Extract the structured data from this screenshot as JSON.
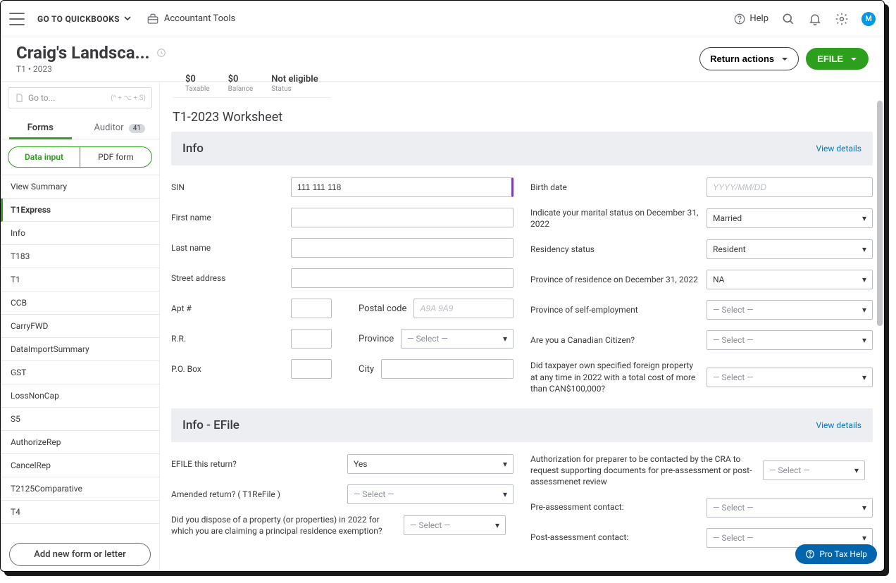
{
  "topbar": {
    "go_to_quickbooks": "GO TO QUICKBOOKS",
    "accountant_tools": "Accountant Tools",
    "help": "Help",
    "avatar_letter": "M"
  },
  "header": {
    "title": "Craig's Landsca...",
    "subtitle": "T1 • 2023",
    "return_actions": "Return actions",
    "efile": "EFILE"
  },
  "summary": {
    "taxable_val": "$0",
    "taxable_lab": "Taxable",
    "balance_val": "$0",
    "balance_lab": "Balance",
    "status_val": "Not eligible",
    "status_lab": "Status"
  },
  "goto": {
    "placeholder": "Go to...",
    "shortcut": "(^ + ⌥ + S)"
  },
  "tabs": {
    "forms": "Forms",
    "auditor": "Auditor",
    "auditor_count": "41"
  },
  "toggle": {
    "data_input": "Data input",
    "pdf_form": "PDF form"
  },
  "form_items": [
    "View Summary",
    "T1Express",
    "Info",
    "T183",
    "T1",
    "CCB",
    "CarryFWD",
    "DataImportSummary",
    "GST",
    "LossNonCap",
    "S5",
    "AuthorizeRep",
    "CancelRep",
    "T2125Comparative",
    "T4"
  ],
  "add_form": "Add new form or letter",
  "main": {
    "title": "T1-2023 Worksheet",
    "section_info": "Info",
    "section_efile": "Info - EFile",
    "view_details": "View details"
  },
  "fields": {
    "sin_lab": "SIN",
    "sin_val": "111 111 118",
    "first_name": "First name",
    "last_name": "Last name",
    "street": "Street address",
    "apt": "Apt #",
    "postal": "Postal code",
    "postal_ph": "A9A 9A9",
    "rr": "R.R.",
    "province": "Province",
    "pobox": "P.O. Box",
    "city": "City",
    "birth_lab": "Birth date",
    "birth_ph": "YYYY/MM/DD",
    "marital_lab": "Indicate your marital status on December 31, 2022",
    "marital_val": "Married",
    "residency_lab": "Residency status",
    "residency_val": "Resident",
    "prov_res_lab": "Province of residence on December 31, 2022",
    "prov_res_val": "NA",
    "prov_self_lab": "Province of self-employment",
    "citizen_lab": "Are you a Canadian Citizen?",
    "foreign_lab": "Did taxpayer own specified foreign property at any time in 2022 with a total cost of more than CAN$100,000?",
    "select_ph": "— Select —",
    "efile_return_lab": "EFILE this return?",
    "efile_return_val": "Yes",
    "amended_lab": "Amended return? ( T1ReFile )",
    "dispose_lab": "Did you dispose of a property (or properties) in 2022 for which you are claiming a principal residence exemption?",
    "auth_lab": "Authorization for preparer to be contacted by the CRA to request supporting documents for pre-assessment or post-assessmenet review",
    "pre_lab": "Pre-assessment contact:",
    "post_lab": "Post-assessment contact:"
  },
  "protax": "Pro Tax Help"
}
